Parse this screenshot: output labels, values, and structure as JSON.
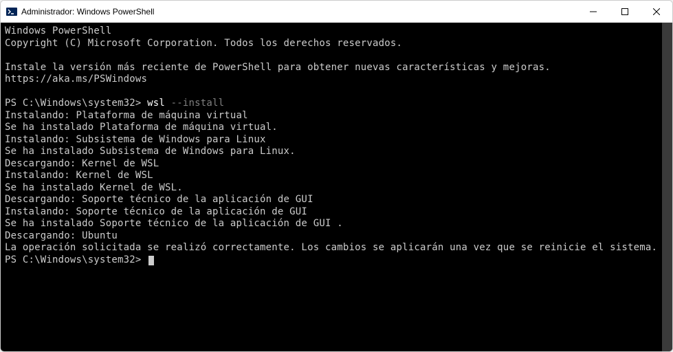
{
  "titlebar": {
    "title": "Administrador: Windows PowerShell"
  },
  "terminal": {
    "banner1": "Windows PowerShell",
    "banner2": "Copyright (C) Microsoft Corporation. Todos los derechos reservados.",
    "banner3": "Instale la versión más reciente de PowerShell para obtener nuevas características y mejoras. https://aka.ms/PSWindows",
    "prompt1_path": "PS C:\\Windows\\system32>",
    "cmd_exe": "wsl",
    "cmd_arg": "--install",
    "lines": [
      "Instalando: Plataforma de máquina virtual",
      "Se ha instalado Plataforma de máquina virtual.",
      "Instalando: Subsistema de Windows para Linux",
      "Se ha instalado Subsistema de Windows para Linux.",
      "Descargando: Kernel de WSL",
      "Instalando: Kernel de WSL",
      "Se ha instalado Kernel de WSL.",
      "Descargando: Soporte técnico de la aplicación de GUI",
      "Instalando: Soporte técnico de la aplicación de GUI",
      "Se ha instalado Soporte técnico de la aplicación de GUI .",
      "Descargando: Ubuntu",
      "La operación solicitada se realizó correctamente. Los cambios se aplicarán una vez que se reinicie el sistema."
    ],
    "prompt2_path": "PS C:\\Windows\\system32>"
  }
}
